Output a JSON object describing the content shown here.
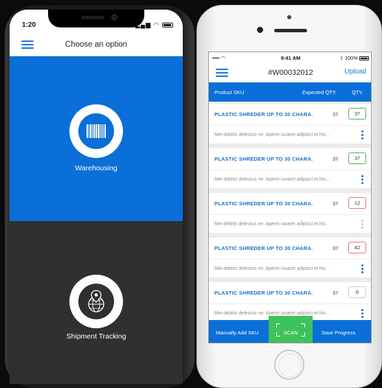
{
  "left_phone": {
    "status_time": "1:20",
    "nav_title": "Choose an option",
    "options": [
      {
        "label": "Warehousing",
        "icon": "barcode-icon"
      },
      {
        "label": "Shipment Tracking",
        "icon": "globe-pin-icon"
      }
    ]
  },
  "right_phone": {
    "status": {
      "carrier": "•••• ",
      "time": "9:41 AM",
      "battery": "100%"
    },
    "nav": {
      "title": "#W00032012",
      "upload_label": "Upload"
    },
    "table_headers": {
      "sku": "Product SKU",
      "expected": "Expected QTY.",
      "qty": "QTY."
    },
    "rows": [
      {
        "name": "PLASTIC SHREDER UP TO 30 CHARA.",
        "expected": "37",
        "qty": "37",
        "qty_state": "match",
        "description": "Mei debitis delectus ne. Aperiri iuvaret adipisci et his..."
      },
      {
        "name": "PLASTIC SHREDER UP TO 30 CHARA.",
        "expected": "37",
        "qty": "37",
        "qty_state": "match",
        "description": "Mei debitis delectus ne. Aperiri iuvaret adipisci et his..."
      },
      {
        "name": "PLASTIC SHREDER UP TO 30 CHARA.",
        "expected": "37",
        "qty": "12",
        "qty_state": "under",
        "description": "Mei debitis delectus ne. Aperiri iuvaret adipisci et his."
      },
      {
        "name": "PLASTIC SHREDER UP TO 30 CHARA.",
        "expected": "37",
        "qty": "42",
        "qty_state": "over",
        "description": "Mei debitis delectus ne. Aperiri iuvaret adipisci et his..."
      },
      {
        "name": "PLASTIC SHREDER UP TO 30 CHARA.",
        "expected": "37",
        "qty": "0",
        "qty_state": "empty",
        "description": "Mei debitis delectus ne. Aperiri iuvaret adipisci et his..."
      }
    ],
    "footer": {
      "manual_label": "Manually Add SKU",
      "scan_label": "SCAN",
      "save_label": "Save  Progress"
    }
  },
  "colors": {
    "primary_blue": "#0a6fd8",
    "dark_panel": "#303030",
    "scan_green": "#3ec25a",
    "qty_match": "#4caf50",
    "qty_under": "#e57373",
    "qty_over": "#e57373",
    "qty_empty": "#cfcfcf"
  }
}
